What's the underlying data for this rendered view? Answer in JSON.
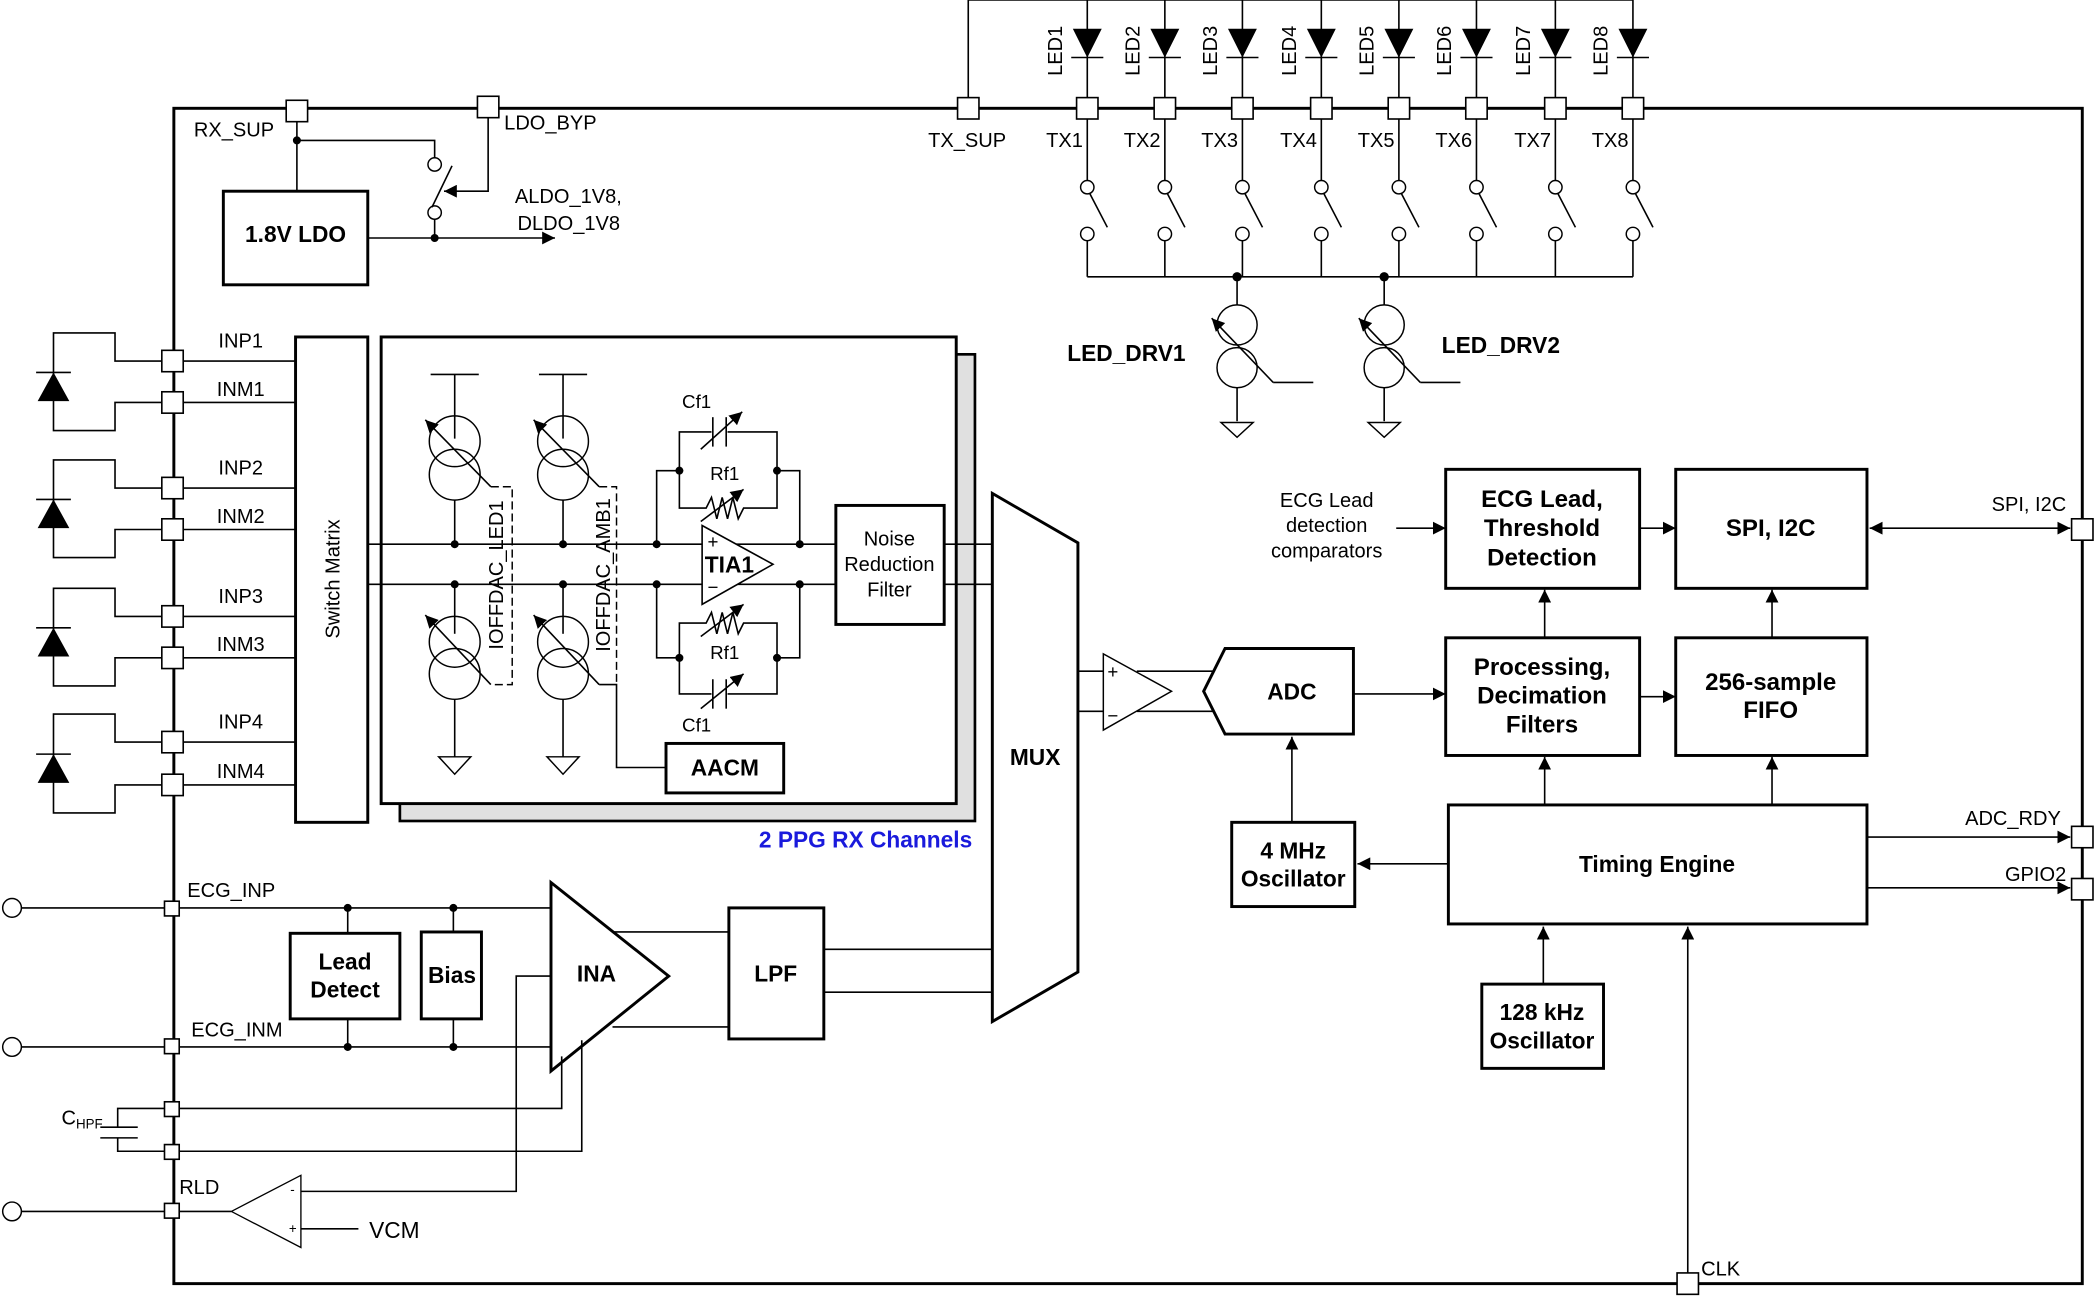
{
  "diagram": {
    "title": "AFE block diagram (PPG + ECG analog front end)",
    "supply_pins": {
      "rx_sup": "RX_SUP",
      "ldo_byp": "LDO_BYP",
      "tx_sup": "TX_SUP"
    },
    "ldo": {
      "label": "1.8V LDO",
      "output_line1": "ALDO_1V8,",
      "output_line2": "DLDO_1V8"
    },
    "leds": [
      "LED1",
      "LED2",
      "LED3",
      "LED4",
      "LED5",
      "LED6",
      "LED7",
      "LED8"
    ],
    "tx_pins": [
      "TX1",
      "TX2",
      "TX3",
      "TX4",
      "TX5",
      "TX6",
      "TX7",
      "TX8"
    ],
    "led_drivers": [
      "LED_DRV1",
      "LED_DRV2"
    ],
    "ppg_inputs": [
      {
        "p": "INP1",
        "m": "INM1"
      },
      {
        "p": "INP2",
        "m": "INM2"
      },
      {
        "p": "INP3",
        "m": "INM3"
      },
      {
        "p": "INP4",
        "m": "INM4"
      }
    ],
    "switch_matrix": "Switch Matrix",
    "ppg_channel": {
      "offset_dac_led": "IOFFDAC_LED1",
      "offset_dac_amb": "IOFFDAC_AMB1",
      "cap_top": "Cf1",
      "res_top": "Rf1",
      "res_bottom": "Rf1",
      "cap_bottom": "Cf1",
      "tia": "TIA1",
      "tia_plus": "+",
      "tia_minus": "−",
      "nrf_line1": "Noise",
      "nrf_line2": "Reduction",
      "nrf_line3": "Filter",
      "aacm": "AACM",
      "caption": "2 PPG RX Channels",
      "caption_color": "#1a1adc"
    },
    "mux": "MUX",
    "buffer": {
      "plus": "+",
      "minus": "−"
    },
    "adc": "ADC",
    "osc_4mhz": {
      "line1": "4 MHz",
      "line2": "Oscillator"
    },
    "osc_128k": {
      "line1": "128 kHz",
      "line2": "Oscillator"
    },
    "ecg_lead_comparators": {
      "line1": "ECG Lead",
      "line2": "detection",
      "line3": "comparators"
    },
    "ecg_threshold": {
      "line1": "ECG Lead,",
      "line2": "Threshold",
      "line3": "Detection"
    },
    "processing": {
      "line1": "Processing,",
      "line2": "Decimation",
      "line3": "Filters"
    },
    "spi_i2c_block": "SPI, I2C",
    "fifo": {
      "line1": "256-sample",
      "line2": "FIFO"
    },
    "timing_engine": "Timing Engine",
    "io_pins": {
      "spi_i2c": "SPI, I2C",
      "adc_rdy": "ADC_RDY",
      "gpio2": "GPIO2",
      "clk": "CLK"
    },
    "ecg": {
      "inp": "ECG_INP",
      "inm": "ECG_INM",
      "lead_detect_line1": "Lead",
      "lead_detect_line2": "Detect",
      "bias": "Bias",
      "ina": "INA",
      "lpf": "LPF",
      "chpf_main": "C",
      "chpf_sub": "HPF",
      "rld": "RLD",
      "vcm": "VCM",
      "rld_plus": "+",
      "rld_minus": "-"
    }
  }
}
